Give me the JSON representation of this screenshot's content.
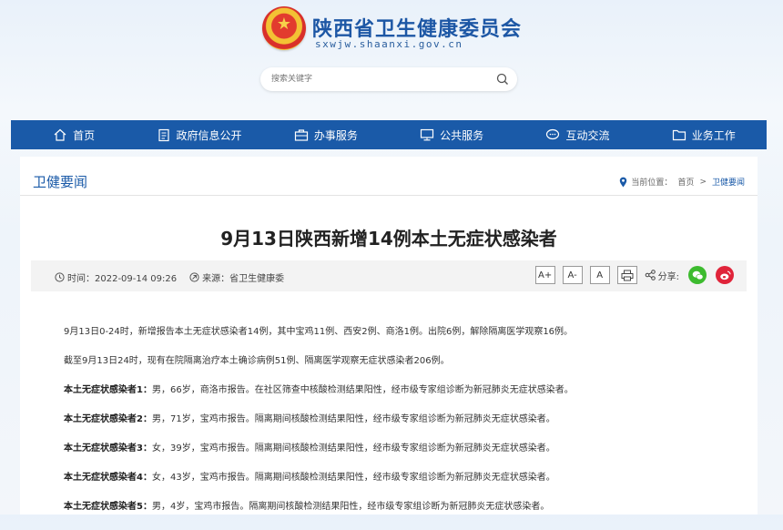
{
  "header": {
    "site_title": "陕西省卫生健康委员会",
    "site_domain": "sxwjw.shaanxi.gov.cn",
    "search_placeholder": "搜索关键字"
  },
  "nav": {
    "items": [
      {
        "label": "首页",
        "icon": "home-icon"
      },
      {
        "label": "政府信息公开",
        "icon": "document-icon"
      },
      {
        "label": "办事服务",
        "icon": "briefcase-icon"
      },
      {
        "label": "公共服务",
        "icon": "monitor-icon"
      },
      {
        "label": "互动交流",
        "icon": "chat-icon"
      },
      {
        "label": "业务工作",
        "icon": "folder-icon"
      }
    ]
  },
  "section": {
    "title": "卫健要闻",
    "breadcrumb_prefix": "当前位置：",
    "breadcrumb_home": "首页",
    "breadcrumb_sep": ">",
    "breadcrumb_current": "卫健要闻"
  },
  "article": {
    "title": "9月13日陕西新增14例本土无症状感染者",
    "time": "时间：2022-09-14 09:26",
    "source": "来源：省卫生健康委",
    "font_large": "A+",
    "font_medium": "A-",
    "font_small": "A",
    "share_label": "分享:",
    "paragraphs": [
      "9月13日0-24时，新增报告本土无症状感染者14例，其中宝鸡11例、西安2例、商洛1例。出院6例，解除隔离医学观察16例。",
      "截至9月13日24时，现有在院隔离治疗本土确诊病例51例、隔离医学观察无症状感染者206例。"
    ],
    "cases": [
      {
        "label": "本土无症状感染者1：",
        "text": "男，66岁，商洛市报告。在社区筛查中核酸检测结果阳性，经市级专家组诊断为新冠肺炎无症状感染者。"
      },
      {
        "label": "本土无症状感染者2：",
        "text": "男，71岁，宝鸡市报告。隔离期间核酸检测结果阳性，经市级专家组诊断为新冠肺炎无症状感染者。"
      },
      {
        "label": "本土无症状感染者3：",
        "text": "女，39岁，宝鸡市报告。隔离期间核酸检测结果阳性，经市级专家组诊断为新冠肺炎无症状感染者。"
      },
      {
        "label": "本土无症状感染者4：",
        "text": "女，43岁，宝鸡市报告。隔离期间核酸检测结果阳性，经市级专家组诊断为新冠肺炎无症状感染者。"
      },
      {
        "label": "本土无症状感染者5：",
        "text": "男，4岁，宝鸡市报告。隔离期间核酸检测结果阳性，经市级专家组诊断为新冠肺炎无症状感染者。"
      }
    ]
  },
  "colors": {
    "nav_bg": "#1a5aa8",
    "title_blue": "#1d57a5",
    "wechat": "#3dbb2f",
    "weibo": "#e0243a"
  }
}
